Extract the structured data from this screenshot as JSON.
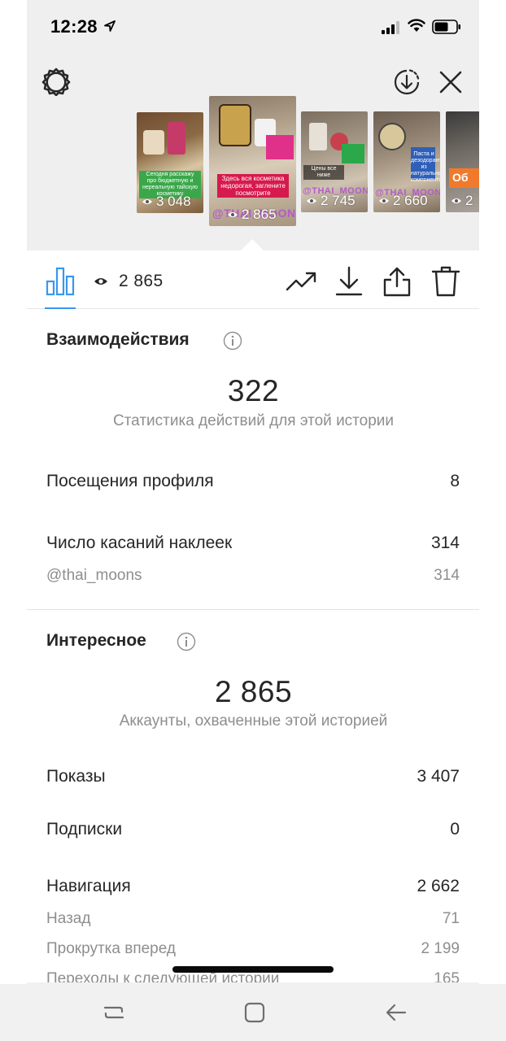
{
  "status_bar": {
    "time": "12:28"
  },
  "stories": [
    {
      "views": "3 048",
      "caption": "Сегодня расскажу про бюджетную и нереальную тайскую косметику",
      "handle": "",
      "accent": "#3aa84a"
    },
    {
      "views": "2 865",
      "caption": "Здесь вся косметика недорогая, заглените посмотрите",
      "handle": "@THAI_MOONS",
      "accent": "#d61a4d"
    },
    {
      "views": "2 745",
      "caption": "Цены все ниже",
      "handle": "@THAI_MOONS",
      "accent": "#2aa84a"
    },
    {
      "views": "2 660",
      "caption": "Паста и дезодорант из натуральных компонентов",
      "handle": "@THAI_MOONS",
      "accent": "#2f5fb8"
    },
    {
      "views": "2",
      "caption": "Об",
      "handle": "",
      "accent": "#f07a2c"
    }
  ],
  "toolbar": {
    "view_count": "2 865"
  },
  "interactions": {
    "title": "Взаимодействия",
    "total": "322",
    "subtitle": "Статистика действий для этой истории",
    "rows": [
      {
        "label": "Посещения профиля",
        "value": "8"
      },
      {
        "label": "Число касаний наклеек",
        "value": "314"
      }
    ],
    "sub_rows": [
      {
        "label": "@thai_moons",
        "value": "314"
      }
    ]
  },
  "discovery": {
    "title": "Интересное",
    "total": "2 865",
    "subtitle": "Аккаунты, охваченные этой историей",
    "rows": [
      {
        "label": "Показы",
        "value": "3 407"
      },
      {
        "label": "Подписки",
        "value": "0"
      },
      {
        "label": "Навигация",
        "value": "2 662"
      }
    ],
    "sub_rows": [
      {
        "label": "Назад",
        "value": "71"
      },
      {
        "label": "Прокрутка вперед",
        "value": "2 199"
      },
      {
        "label": "Переходы к следующей истории",
        "value": "165"
      }
    ]
  },
  "colors": {
    "accent_blue": "#3897f0",
    "top_background": "#efefef",
    "text_primary": "#262626",
    "text_secondary": "#8e8e8e"
  }
}
